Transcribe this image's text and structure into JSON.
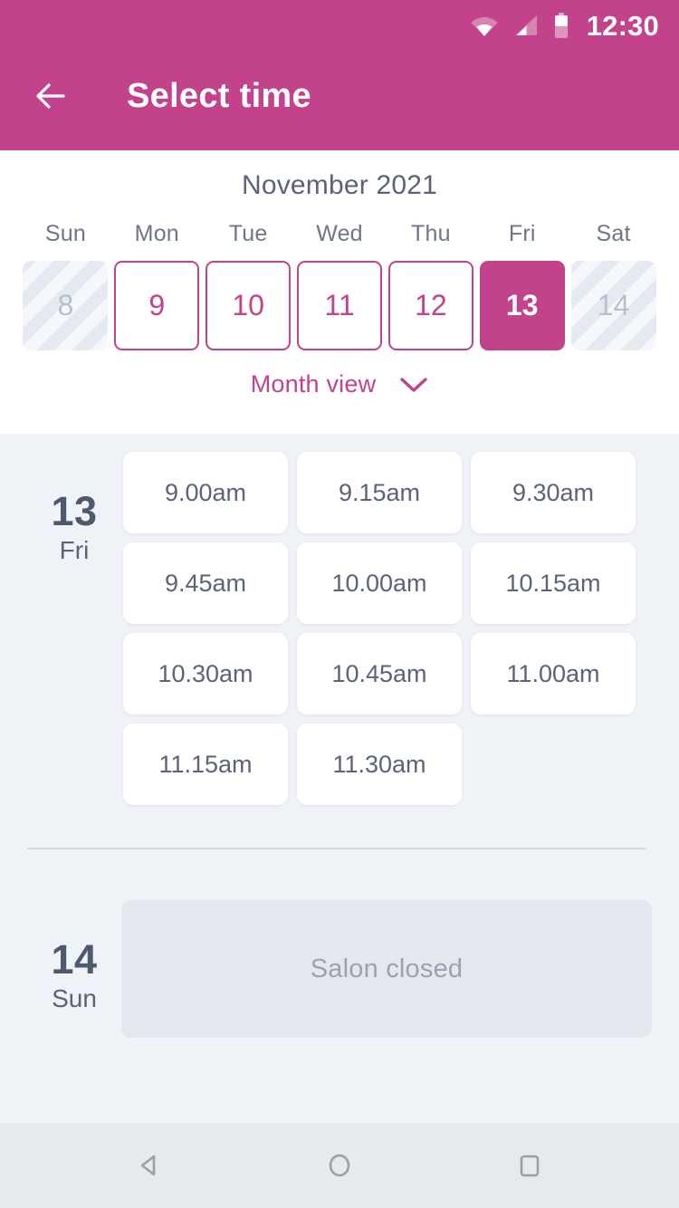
{
  "status_bar": {
    "time": "12:30",
    "icons": [
      "wifi-icon",
      "signal-icon",
      "battery-icon"
    ]
  },
  "header": {
    "title": "Select time",
    "back_icon": "arrow-left-icon",
    "background_color": "#c2428b"
  },
  "calendar": {
    "month_title": "November 2021",
    "weekdays": [
      "Sun",
      "Mon",
      "Tue",
      "Wed",
      "Thu",
      "Fri",
      "Sat"
    ],
    "days": [
      {
        "number": "8",
        "state": "disabled"
      },
      {
        "number": "9",
        "state": "available"
      },
      {
        "number": "10",
        "state": "available"
      },
      {
        "number": "11",
        "state": "available"
      },
      {
        "number": "12",
        "state": "available"
      },
      {
        "number": "13",
        "state": "selected"
      },
      {
        "number": "14",
        "state": "disabled"
      }
    ],
    "view_toggle": {
      "label": "Month view",
      "icon": "chevron-down-icon"
    },
    "accent_color": "#c2428b"
  },
  "schedule": [
    {
      "day_number": "13",
      "day_name": "Fri",
      "slots": [
        "9.00am",
        "9.15am",
        "9.30am",
        "9.45am",
        "10.00am",
        "10.15am",
        "10.30am",
        "10.45am",
        "11.00am",
        "11.15am",
        "11.30am"
      ]
    },
    {
      "day_number": "14",
      "day_name": "Sun",
      "closed_message": "Salon closed"
    }
  ],
  "nav_bar": {
    "back": "nav-back-icon",
    "home": "nav-home-icon",
    "recents": "nav-recents-icon"
  }
}
